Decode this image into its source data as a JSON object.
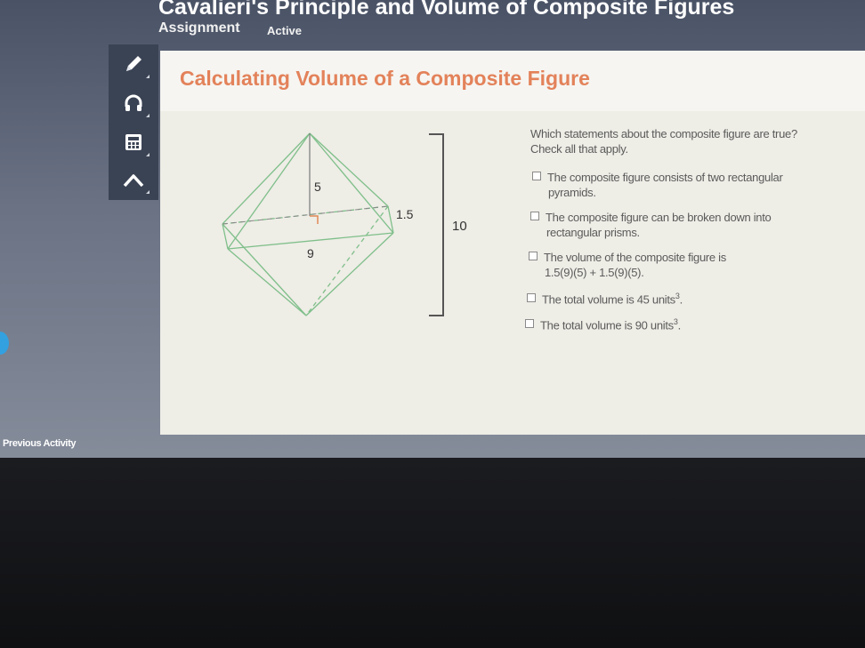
{
  "header": {
    "title": "Cavalieri's Principle and Volume of Composite Figures",
    "assignment_label": "Assignment",
    "status_label": "Active"
  },
  "toolbar": {
    "tools": [
      {
        "name": "pencil-icon"
      },
      {
        "name": "headphones-icon"
      },
      {
        "name": "calculator-icon"
      },
      {
        "name": "collapse-icon"
      }
    ]
  },
  "panel": {
    "title": "Calculating Volume of a Composite Figure"
  },
  "figure": {
    "label_height_top": "5",
    "label_side": "1.5",
    "label_base": "9",
    "label_total": "10"
  },
  "question": {
    "prompt": "Which statements about the composite figure are true?",
    "instruction": "Check all that apply.",
    "options": [
      {
        "line1": "The composite figure consists of two rectangular",
        "line2": "pyramids."
      },
      {
        "line1": "The composite figure can be broken down into",
        "line2": "rectangular prisms."
      },
      {
        "line1": "The volume of the composite figure is",
        "line2": "1.5(9)(5) + 1.5(9)(5)."
      },
      {
        "line1": "The total volume is 45 units",
        "sup": "3",
        "tail": "."
      },
      {
        "line1": "The total volume is 90 units",
        "sup": "3",
        "tail": "."
      }
    ]
  },
  "footer": {
    "previous_activity": "Previous Activity"
  },
  "colors": {
    "panel_title": "#e3825a",
    "toolbar_bg": "#3a4354",
    "figure_line": "#7fbf8a"
  }
}
